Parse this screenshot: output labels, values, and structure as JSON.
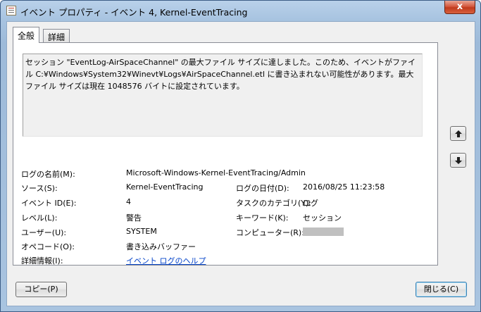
{
  "window": {
    "title": "イベント プロパティ - イベント 4, Kernel-EventTracing",
    "close_label": "x"
  },
  "tabs": [
    {
      "label": "全般"
    },
    {
      "label": "詳細"
    }
  ],
  "event": {
    "description": "セッション \"EventLog-AirSpaceChannel\" の最大ファイル サイズに達しました。このため、イベントがファイル C:¥Windows¥System32¥Winevt¥Logs¥AirSpaceChannel.etl に書き込まれない可能性があります。最大ファイル サイズは現在 1048576 バイトに設定されています。",
    "log_name_label": "ログの名前(M):",
    "log_name_value": "Microsoft-Windows-Kernel-EventTracing/Admin",
    "source_label": "ソース(S):",
    "source_value": "Kernel-EventTracing",
    "logged_label": "ログの日付(D):",
    "logged_value": "2016/08/25 11:23:58",
    "event_id_label": "イベント ID(E):",
    "event_id_value": "4",
    "task_category_label": "タスクのカテゴリ(Y):",
    "task_category_value": "ログ",
    "level_label": "レベル(L):",
    "level_value": "警告",
    "keywords_label": "キーワード(K):",
    "keywords_value": "セッション",
    "user_label": "ユーザー(U):",
    "user_value": "SYSTEM",
    "computer_label": "コンピューター(R):",
    "opcode_label": "オペコード(O):",
    "opcode_value": "書き込みバッファー",
    "more_info_label": "詳細情報(I):",
    "more_info_link": "イベント ログのヘルプ"
  },
  "buttons": {
    "copy": "コピー(P)",
    "close": "閉じる(C)"
  },
  "icons": {
    "up": "arrow-up-icon",
    "down": "arrow-down-icon"
  }
}
